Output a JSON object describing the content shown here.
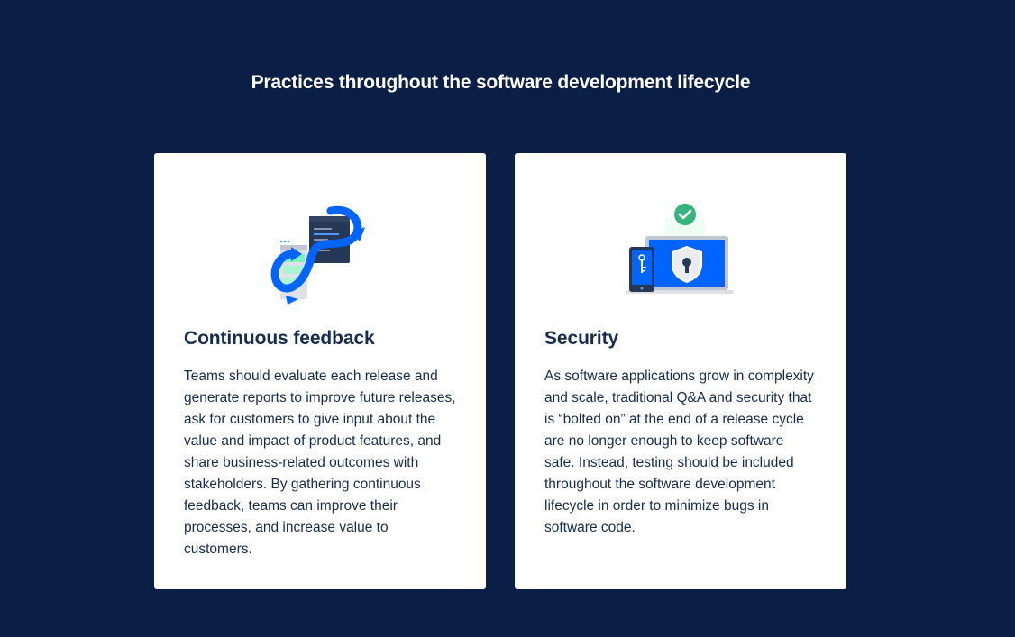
{
  "section": {
    "title": "Practices throughout the software development lifecycle"
  },
  "cards": [
    {
      "title": "Continuous feedback",
      "body": "Teams should evaluate each release and generate reports to improve future releases, ask for customers to give input about the value and impact of product features, and share business-related outcomes with stakeholders. By gathering continuous feedback, teams can improve their processes, and increase value to customers.",
      "icon": "continuous-feedback-illustration"
    },
    {
      "title": "Security",
      "body": "As software applications grow in complexity and scale, traditional Q&A and security that is “bolted on” at the end of a release cycle are no longer enough to keep software safe. Instead, testing should be included throughout the software development lifecycle in order to minimize bugs in software code.",
      "icon": "security-illustration"
    }
  ],
  "colors": {
    "background": "#0b1e45",
    "card": "#ffffff",
    "text": "#172b4d",
    "accent_blue": "#0065ff",
    "success_green": "#36b37e"
  }
}
